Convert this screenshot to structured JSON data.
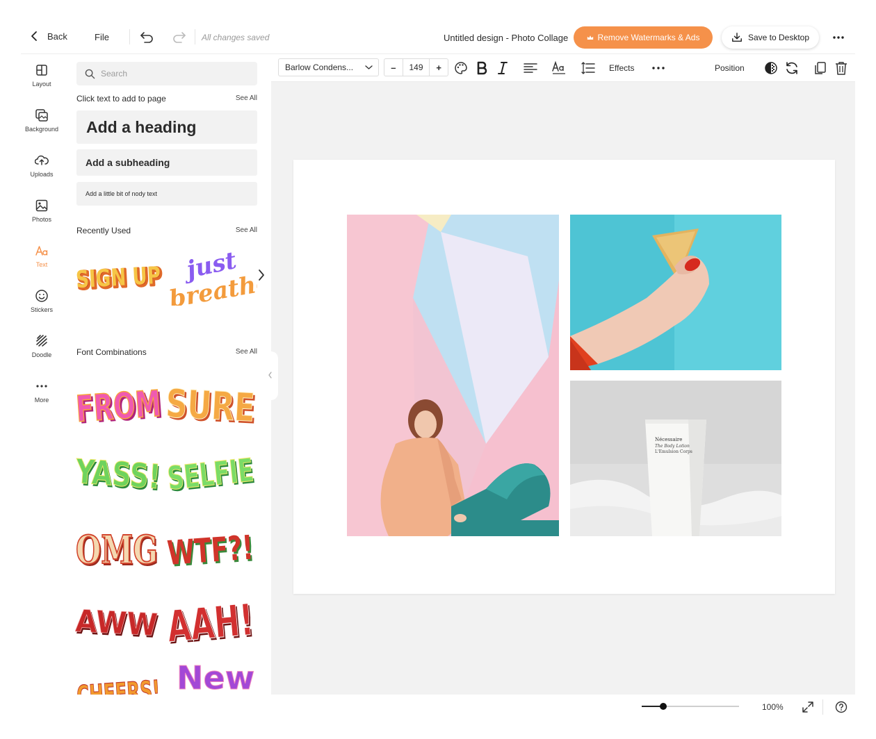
{
  "topbar": {
    "back_label": "Back",
    "file_label": "File",
    "status": "All changes saved",
    "document_title": "Untitled design - Photo Collage",
    "remove_label": "Remove Watermarks & Ads",
    "save_label": "Save to Desktop",
    "accent_color": "#f5914a"
  },
  "rail": {
    "items": [
      {
        "label": "Layout",
        "icon": "layout-icon"
      },
      {
        "label": "Background",
        "icon": "background-icon"
      },
      {
        "label": "Uploads",
        "icon": "upload-cloud-icon"
      },
      {
        "label": "Photos",
        "icon": "photo-icon"
      },
      {
        "label": "Text",
        "icon": "text-icon",
        "active": true
      },
      {
        "label": "Stickers",
        "icon": "smiley-icon"
      },
      {
        "label": "Doodle",
        "icon": "doodle-icon"
      },
      {
        "label": "More",
        "icon": "more-dots-icon"
      }
    ]
  },
  "panel": {
    "search_placeholder": "Search",
    "click_text_label": "Click text to add to page",
    "see_all": "See All",
    "heading_label": "Add a heading",
    "subheading_label": "Add a subheading",
    "body_label": "Add a little bit of nody text",
    "recently_used_label": "Recently Used",
    "font_combinations_label": "Font Combinations",
    "recent_stickers": [
      "SIGN UP",
      "just",
      "breathe"
    ],
    "combo_stickers": [
      "FROM",
      "SURE",
      "YASS!",
      "SELFIE",
      "OMG",
      "WTF?!",
      "AWW",
      "AAH!",
      "CHEERS!",
      "New"
    ]
  },
  "toolbar": {
    "font_name": "Barlow Condens...",
    "font_size": "149",
    "minus": "–",
    "plus": "+",
    "effects_label": "Effects",
    "position_label": "Position"
  },
  "canvas": {
    "photos": [
      {
        "name": "woman-pastel-background-photo"
      },
      {
        "name": "hand-holding-chip-photo"
      },
      {
        "name": "lotion-tube-photo",
        "product_text": [
          "Nécessaire",
          "The Body Lotion",
          "L'Emulsion Corps"
        ]
      }
    ]
  },
  "footer": {
    "zoom_value": "100%",
    "zoom_level": 0.22
  }
}
